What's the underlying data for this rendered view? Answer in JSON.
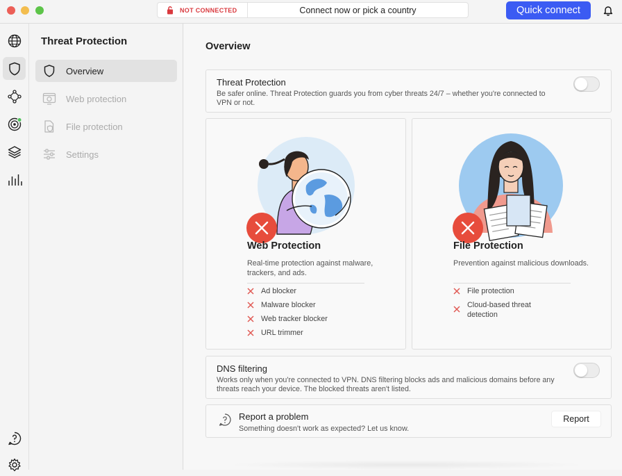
{
  "titlebar": {
    "status": "NOT CONNECTED",
    "connect_prompt": "Connect now or pick a country",
    "quick_connect_label": "Quick connect",
    "status_color": "#d9393e",
    "accent": "#3b5bf3"
  },
  "rail": {
    "icons": [
      "globe-icon",
      "shield-icon",
      "meshnet-icon",
      "target-icon",
      "layers-icon",
      "stats-icon",
      "help-icon",
      "settings-gear-icon"
    ]
  },
  "submenu": {
    "title": "Threat Protection",
    "items": [
      {
        "label": "Overview",
        "icon": "shield-outline-icon",
        "active": true
      },
      {
        "label": "Web protection",
        "icon": "browser-shield-icon",
        "active": false
      },
      {
        "label": "File protection",
        "icon": "file-shield-icon",
        "active": false
      },
      {
        "label": "Settings",
        "icon": "sliders-icon",
        "active": false
      }
    ]
  },
  "main": {
    "title": "Overview",
    "threat_protection": {
      "title": "Threat Protection",
      "description": "Be safer online. Threat Protection guards you from cyber threats 24/7 – whether you're connected to VPN or not.",
      "enabled": false
    },
    "web_protection": {
      "title": "Web Protection",
      "description": "Real-time protection against malware, trackers, and ads.",
      "features": [
        "Ad blocker",
        "Malware blocker",
        "Web tracker blocker",
        "URL trimmer"
      ]
    },
    "file_protection": {
      "title": "File Protection",
      "description": "Prevention against malicious downloads.",
      "features": [
        "File protection",
        "Cloud-based threat detection"
      ]
    },
    "dns_filtering": {
      "title": "DNS filtering",
      "description": "Works only when you're connected to VPN. DNS filtering blocks ads and malicious domains before any threats reach your device. The blocked threats aren't listed.",
      "enabled": false
    },
    "report": {
      "title": "Report a problem",
      "description": "Something doesn't work as expected? Let us know.",
      "button_label": "Report"
    }
  }
}
